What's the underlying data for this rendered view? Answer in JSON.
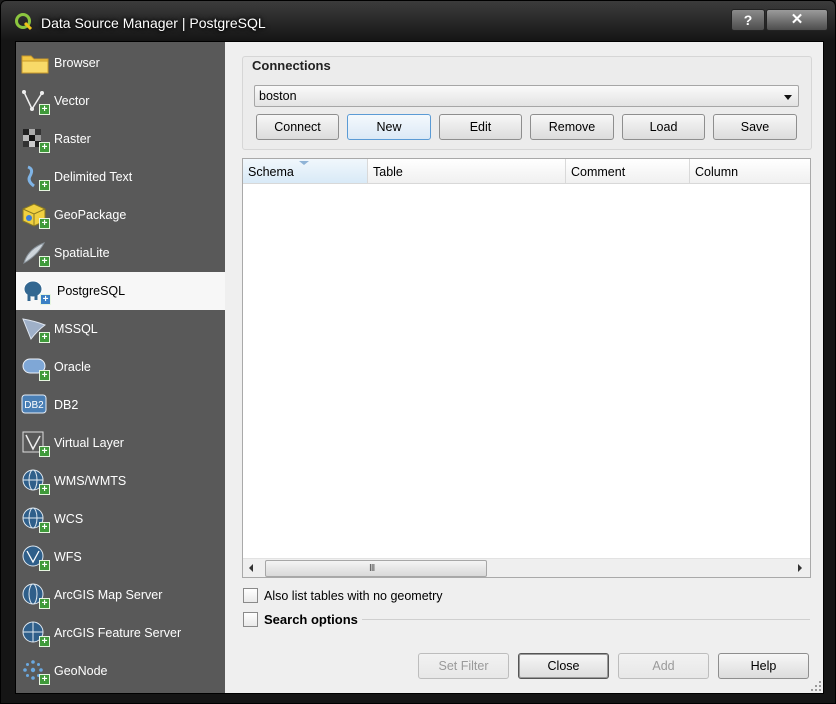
{
  "window": {
    "title": "Data Source Manager | PostgreSQL",
    "help_label": "?",
    "close_label": "✕"
  },
  "sidebar": {
    "items": [
      {
        "label": "Browser",
        "icon": "folder-icon"
      },
      {
        "label": "Vector",
        "icon": "vector-icon"
      },
      {
        "label": "Raster",
        "icon": "raster-icon"
      },
      {
        "label": "Delimited Text",
        "icon": "delimited-text-icon"
      },
      {
        "label": "GeoPackage",
        "icon": "geopackage-icon"
      },
      {
        "label": "SpatiaLite",
        "icon": "spatialite-icon"
      },
      {
        "label": "PostgreSQL",
        "icon": "postgresql-elephant-icon",
        "selected": true
      },
      {
        "label": "MSSQL",
        "icon": "mssql-icon"
      },
      {
        "label": "Oracle",
        "icon": "oracle-icon"
      },
      {
        "label": "DB2",
        "icon": "db2-icon"
      },
      {
        "label": "Virtual Layer",
        "icon": "virtual-layer-icon"
      },
      {
        "label": "WMS/WMTS",
        "icon": "wms-globe-icon"
      },
      {
        "label": "WCS",
        "icon": "wcs-globe-icon"
      },
      {
        "label": "WFS",
        "icon": "wfs-globe-icon"
      },
      {
        "label": "ArcGIS Map Server",
        "icon": "arcgis-map-server-icon"
      },
      {
        "label": "ArcGIS Feature Server",
        "icon": "arcgis-feature-server-icon"
      },
      {
        "label": "GeoNode",
        "icon": "geonode-icon"
      }
    ]
  },
  "connections": {
    "group_title": "Connections",
    "selected_connection": "boston",
    "buttons": {
      "connect": "Connect",
      "new": "New",
      "edit": "Edit",
      "remove": "Remove",
      "load": "Load",
      "save": "Save"
    }
  },
  "table": {
    "columns": [
      "Schema",
      "Table",
      "Comment",
      "Column"
    ],
    "rows": [],
    "sorted_column": "Schema",
    "scroll_grip": "III"
  },
  "options": {
    "list_no_geometry_label": "Also list tables with no geometry",
    "list_no_geometry_checked": false,
    "search_options_label": "Search options",
    "search_options_checked": false
  },
  "footer": {
    "set_filter": "Set Filter",
    "close": "Close",
    "add": "Add",
    "help": "Help"
  },
  "colors": {
    "sidebar_bg": "#595959",
    "selected_bg": "#f7f7f7",
    "plus_badge": "#3f9a3a"
  }
}
